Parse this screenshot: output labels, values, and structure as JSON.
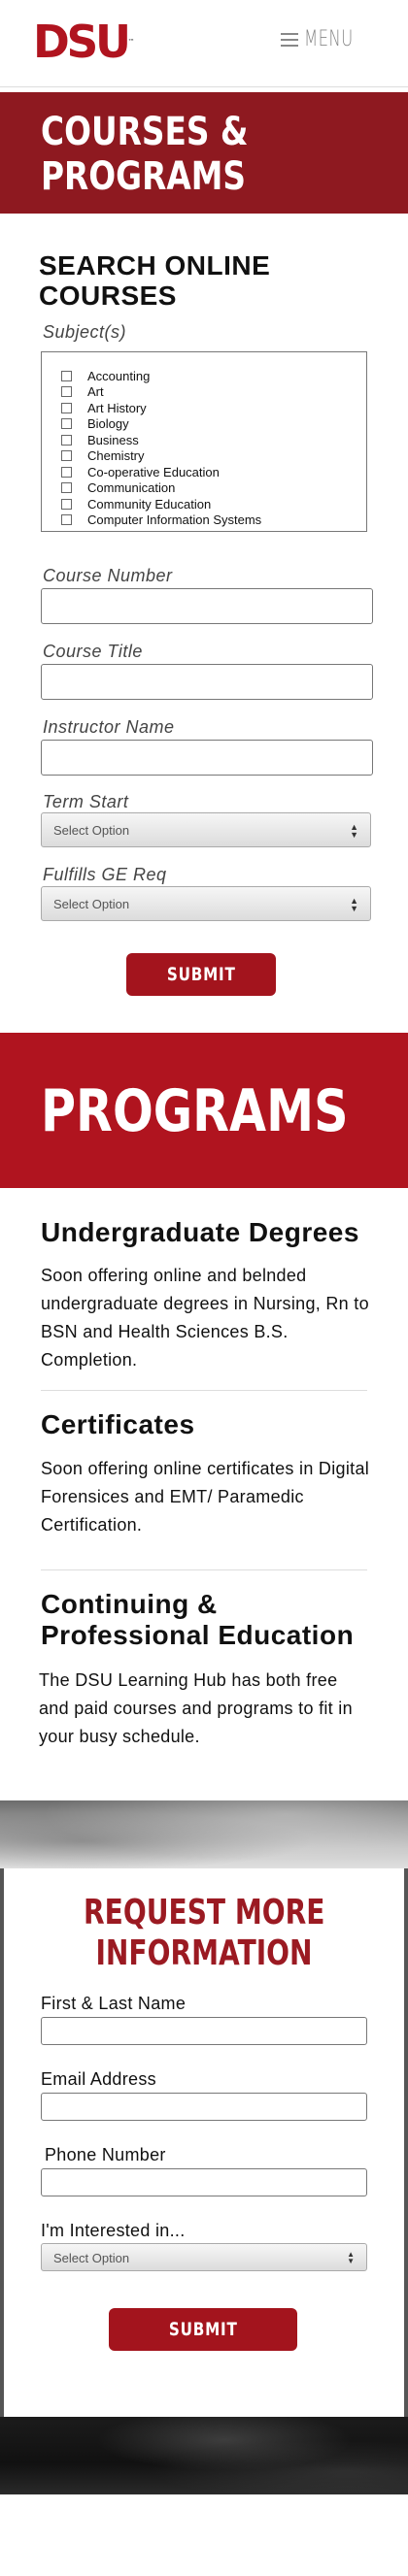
{
  "header": {
    "logo_text": "DSU",
    "logo_tm": "™",
    "menu_label": "MENU"
  },
  "courses_banner": {
    "title": "Courses & Programs"
  },
  "search": {
    "heading": "Search Online Courses",
    "subjects_label": "Subject(s)",
    "subjects": [
      "Accounting",
      "Art",
      "Art History",
      "Biology",
      "Business",
      "Chemistry",
      "Co-operative Education",
      "Communication",
      "Community Education",
      "Computer Information Systems"
    ],
    "course_number_label": "Course Number",
    "course_title_label": "Course Title",
    "instructor_label": "Instructor Name",
    "term_start_label": "Term Start",
    "term_start_value": "Select Option",
    "ge_req_label": "Fulfills GE Req",
    "ge_req_value": "Select Option",
    "submit_label": "SUBMIT"
  },
  "programs_banner": {
    "title": "Programs"
  },
  "programs": [
    {
      "title": "Undergraduate Degrees",
      "text": "Soon offering online and belnded undergraduate degrees in Nursing, Rn to BSN and Health Sciences B.S. Completion."
    },
    {
      "title": "Certificates",
      "text": "Soon offering online certificates in Digital Forensices and EMT/ Paramedic Certification."
    },
    {
      "title": "Continuing & Professional Education",
      "text": "The DSU Learning Hub has both free and paid courses and programs to fit in your busy schedule."
    }
  ],
  "request": {
    "heading_line1": "Request More",
    "heading_line2": "Information",
    "name_label": "First & Last Name",
    "email_label": "Email Address",
    "phone_label": "Phone Number",
    "interest_label": "I'm Interested in...",
    "interest_value": "Select Option",
    "submit_label": "SUBMIT"
  },
  "colors": {
    "brand_red": "#b0141f",
    "dark_red": "#8e1920",
    "button_red": "#a3141d"
  }
}
